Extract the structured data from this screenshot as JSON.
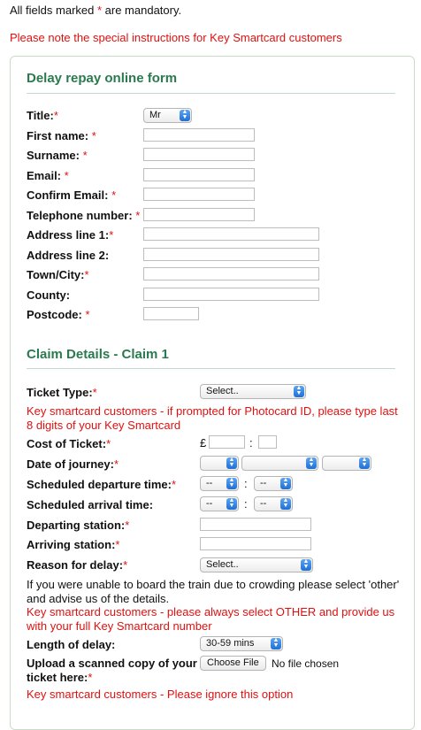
{
  "top": {
    "mandatory_pre": "All fields marked ",
    "mandatory_ast": "*",
    "mandatory_post": " are mandatory.",
    "key_note": "Please note the special instructions for Key Smartcard customers"
  },
  "form": {
    "title": "Delay repay online form",
    "fields": {
      "title": {
        "label": "Title:",
        "value": "Mr"
      },
      "first_name": {
        "label": "First name:"
      },
      "surname": {
        "label": "Surname:"
      },
      "email": {
        "label": "Email:"
      },
      "confirm_email": {
        "label": "Confirm Email:"
      },
      "telephone": {
        "label": "Telephone number:"
      },
      "address1": {
        "label": "Address line 1:"
      },
      "address2": {
        "label": "Address line 2:"
      },
      "town": {
        "label": "Town/City:"
      },
      "county": {
        "label": "County:"
      },
      "postcode": {
        "label": "Postcode:"
      }
    }
  },
  "claim": {
    "title": "Claim Details - Claim 1",
    "ticket_type": {
      "label": "Ticket Type:",
      "value": "Select.."
    },
    "photocard_note": "Key smartcard customers - if prompted for Photocard ID, please type last 8 digits of your Key Smartcard",
    "cost": {
      "label": "Cost of Ticket:",
      "currency": "£",
      "separator": ":"
    },
    "date": {
      "label": "Date of journey:"
    },
    "departure_time": {
      "label": "Scheduled departure time:",
      "hour": "--",
      "minute": "--",
      "separator": ":"
    },
    "arrival_time": {
      "label": "Scheduled arrival time:",
      "hour": "--",
      "minute": "--",
      "separator": ":"
    },
    "departing_station": {
      "label": "Departing station:"
    },
    "arriving_station": {
      "label": "Arriving station:"
    },
    "reason": {
      "label": "Reason for delay:",
      "value": "Select.."
    },
    "crowding_note": "If you were unable to board the train due to crowding please select 'other' and advise us of the details.",
    "other_note": "Key smartcard customers - please always select OTHER and provide us with your full Key Smartcard number",
    "length": {
      "label": "Length of delay:",
      "value": "30-59 mins"
    },
    "upload": {
      "label_line1": "Upload a scanned copy of your",
      "label_line2": "ticket here:",
      "button": "Choose File",
      "status": "No file chosen"
    },
    "ignore_note": "Key smartcard customers - Please ignore this option"
  },
  "colors": {
    "accent_green": "#2a7a4f",
    "required_red": "#e01010",
    "select_blue": "#1f6fd6"
  }
}
